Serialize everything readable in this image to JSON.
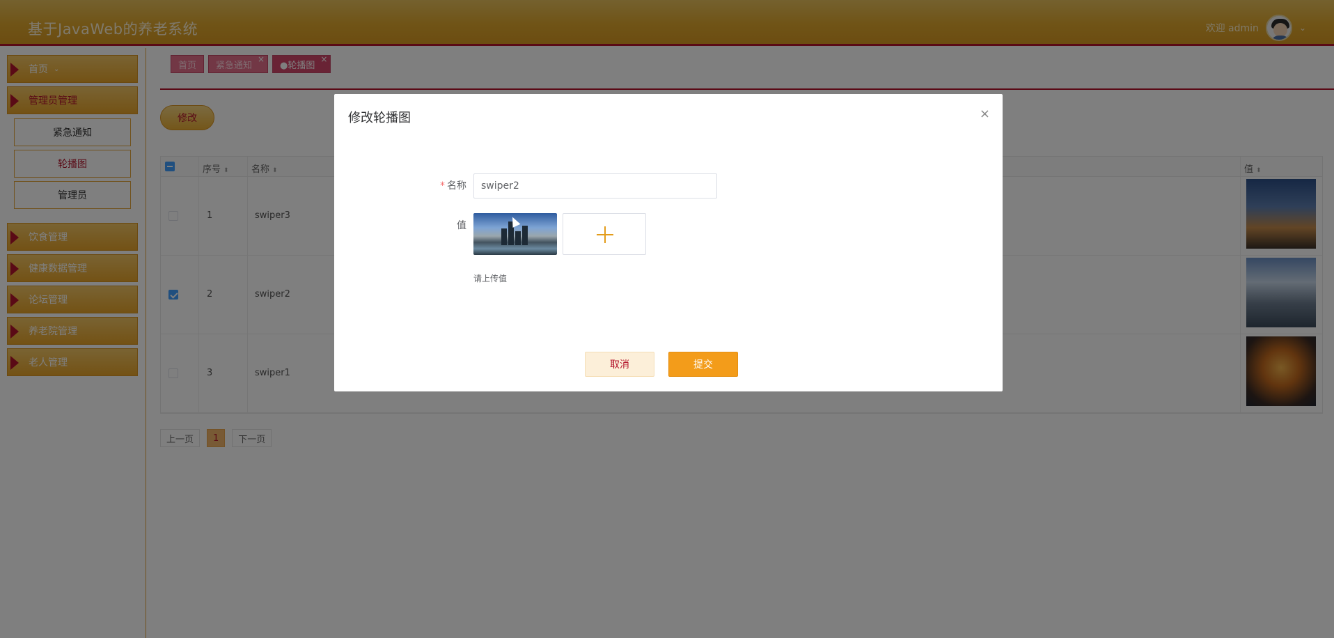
{
  "header": {
    "title": "基于JavaWeb的养老系统",
    "welcome": "欢迎 admin",
    "avatar_icon": "avatar-icon",
    "dropdown_icon": "chevron-down-icon"
  },
  "sidebar": {
    "home": "首页",
    "admin_mgmt": "管理员管理",
    "submenu": [
      "紧急通知",
      "轮播图",
      "管理员"
    ],
    "items": [
      "饮食管理",
      "健康数据管理",
      "论坛管理",
      "养老院管理",
      "老人管理"
    ]
  },
  "tabs": [
    {
      "label": "首页"
    },
    {
      "label": "紧急通知",
      "close": "×"
    },
    {
      "label": "●轮播图",
      "close": "×"
    }
  ],
  "toolbar": {
    "edit_label": "修改"
  },
  "table": {
    "columns": [
      "序号",
      "名称",
      "值"
    ],
    "rows": [
      {
        "index": "1",
        "name": "swiper3",
        "checked": false
      },
      {
        "index": "2",
        "name": "swiper2",
        "checked": true
      },
      {
        "index": "3",
        "name": "swiper1",
        "checked": false
      }
    ]
  },
  "pagination": {
    "prev": "上一页",
    "current": "1",
    "next": "下一页"
  },
  "modal": {
    "title": "修改轮播图",
    "close": "×",
    "name_label": "名称",
    "name_value": "swiper2",
    "value_label": "值",
    "upload_hint": "请上传值",
    "cancel": "取消",
    "submit": "提交"
  },
  "colors": {
    "accent": "#e0a82d",
    "brand": "#b4152c",
    "submit": "#f39c1a"
  }
}
